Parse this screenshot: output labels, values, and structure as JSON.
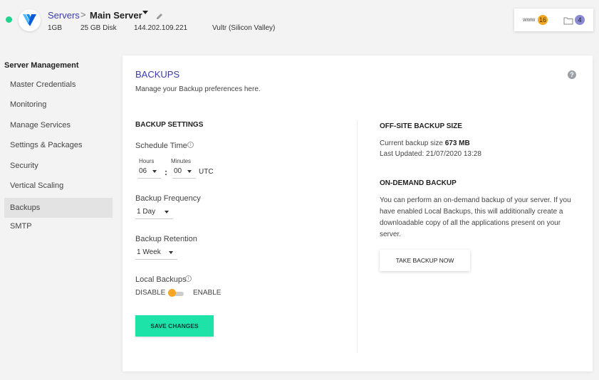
{
  "header": {
    "breadcrumb_root": "Servers",
    "breadcrumb_sep": ">",
    "server_name": "Main Server",
    "ram": "1GB",
    "disk": "25 GB Disk",
    "ip": "144.202.109.221",
    "provider": "Vultr (Silicon Valley)",
    "www_label": "www",
    "www_count": "16",
    "folder_count": "4",
    "status_color": "#1ed38c"
  },
  "sidebar": {
    "title": "Server Management",
    "items": [
      {
        "label": "Master Credentials"
      },
      {
        "label": "Monitoring"
      },
      {
        "label": "Manage Services"
      },
      {
        "label": "Settings & Packages"
      },
      {
        "label": "Security"
      },
      {
        "label": "Vertical Scaling"
      },
      {
        "label": "Backups",
        "active": true
      },
      {
        "label": "SMTP"
      }
    ]
  },
  "main": {
    "title": "BACKUPS",
    "subtitle": "Manage your Backup preferences here.",
    "help_icon": "?",
    "settings": {
      "heading": "BACKUP SETTINGS",
      "schedule_label": "Schedule Time",
      "hours_label": "Hours",
      "minutes_label": "Minutes",
      "hours_value": "06",
      "minutes_value": "00",
      "colon": ":",
      "timezone": "UTC",
      "frequency_label": "Backup Frequency",
      "frequency_value": "1 Day",
      "retention_label": "Backup Retention",
      "retention_value": "1 Week",
      "local_label": "Local Backups",
      "toggle_off": "DISABLE",
      "toggle_on": "ENABLE",
      "save_label": "SAVE CHANGES"
    },
    "offsite": {
      "heading": "OFF-SITE BACKUP SIZE",
      "size_prefix": "Current backup size",
      "size_value": "673 MB",
      "updated": "Last Updated: 21/07/2020 13:28"
    },
    "ondemand": {
      "heading": "ON-DEMAND BACKUP",
      "description": "You can perform an on-demand backup of your server. If you have enabled Local Backups, this will additionally create a downloadable copy of all the applications present on your server.",
      "button_label": "TAKE BACKUP NOW"
    }
  },
  "colors": {
    "accent": "#3a3aa8",
    "primary_button": "#1ee3a8",
    "toggle_knob": "#f5a623",
    "www_badge": "#f5a623",
    "folder_badge": "#8a8ad0"
  }
}
